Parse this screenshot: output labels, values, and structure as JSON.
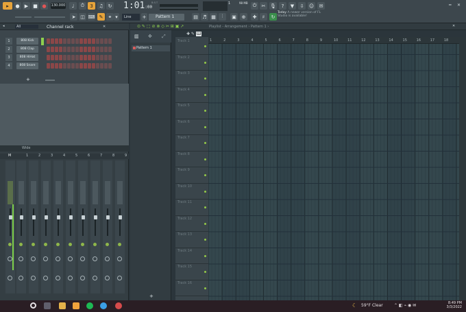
{
  "toolbar": {
    "bpm": "130.000",
    "time_main": "1:01",
    "time_sub": ":00",
    "time_label": "B:S:T",
    "pattern": "Pattern 1",
    "snap": "Line",
    "news_header": "Today",
    "news_text": "A newer version of FL Studio is available!",
    "memory": "98 MB",
    "cpu": "1"
  },
  "channel_rack": {
    "filter": "All",
    "title": "Channel rack",
    "channels": [
      {
        "num": "1",
        "name": "808 Kick"
      },
      {
        "num": "2",
        "name": "808 Clap"
      },
      {
        "num": "3",
        "name": "808 HiHat"
      },
      {
        "num": "4",
        "name": "808 Snare"
      }
    ],
    "add": "+"
  },
  "mixer": {
    "view": "Wide",
    "master": "Master",
    "strips": [
      "M",
      "1",
      "2",
      "3",
      "4",
      "5",
      "6",
      "7",
      "8",
      "9"
    ],
    "insert": "Insert"
  },
  "playlist": {
    "title": "Playlist - Arrangement › Pattern 1 ›",
    "patterns": [
      "Pattern 1"
    ],
    "bars": [
      "1",
      "2",
      "3",
      "4",
      "5",
      "6",
      "7",
      "8",
      "9",
      "10",
      "11",
      "12",
      "13",
      "14",
      "15",
      "16",
      "17",
      "18"
    ],
    "tracks": [
      "Track 1",
      "Track 2",
      "Track 3",
      "Track 4",
      "Track 5",
      "Track 6",
      "Track 7",
      "Track 8",
      "Track 9",
      "Track 10",
      "Track 11",
      "Track 12",
      "Track 13",
      "Track 14",
      "Track 15",
      "Track 16"
    ],
    "add": "+"
  },
  "taskbar": {
    "weather": "59°F  Clear",
    "time": "8:49 PM",
    "date": "3/3/2022"
  },
  "colors": {
    "accent": "#e6a33a",
    "green": "#8fcf4e",
    "step": "#8b4748"
  }
}
